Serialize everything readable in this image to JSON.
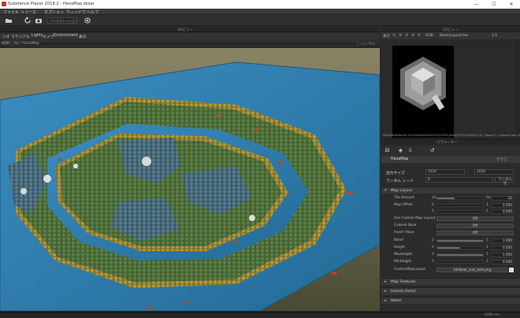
{
  "window": {
    "title": "Substance Player 2018.2 - HexaMap.sbsar",
    "minimize": "—",
    "maximize": "☐",
    "close": "✕"
  },
  "menu": {
    "items": [
      "ファイル",
      "リソース",
      "オプション",
      "ウィンドウ",
      "ヘルプ"
    ]
  },
  "toolbar": {
    "selector": "インテグレーションモード"
  },
  "viewport": {
    "header": "3Dビュー",
    "tabs": [
      "ジオ",
      "マテリアル",
      "Lights",
      "カメラ",
      "Environment",
      "表示"
    ],
    "env_label": "HDR",
    "env_value": "sky / HexaMap",
    "env_right": "ノーマル"
  },
  "preview": {
    "header": "2Dビュー",
    "tools": [
      "表示",
      "①",
      "②",
      "③",
      "④",
      "⑤",
      "RGB",
      "Base/Layout.tex",
      "1:1"
    ],
    "info": "HEXAMAP/BASECOLOR/BOX/HEXA/F/LE/LEVEL/BASE/TXT/CHECK/LCD | Hexa(2) - output3.sbs 2048x2048 | hexa-basecolor.png"
  },
  "properties": {
    "header": "パラメーター",
    "graph_name": "HexaMap",
    "graph_right": "グラフ",
    "output_size_label": "出力サイズ",
    "output_size_w": "1024",
    "output_size_h": "1024",
    "random_seed_label": "ランダム シード",
    "random_seed_value": "0",
    "random_seed_btn": "ランダム化",
    "sections": [
      "Map Layout",
      "Map Features",
      "Islands Detail",
      "Water"
    ],
    "params": [
      {
        "label": "Tile Amount",
        "min": "10",
        "max": "64",
        "value": "32",
        "fill": 0.38
      },
      {
        "label": "Map Offset",
        "min": "0",
        "max": "1",
        "value": "0.000",
        "fill": 0.0
      },
      {
        "label": "",
        "min": "0",
        "max": "1",
        "value": "0.000",
        "fill": 0.0
      },
      {
        "label": "Use Custom Map Layout",
        "wide": "Off"
      },
      {
        "label": "Colored Base",
        "wide": "Off"
      },
      {
        "label": "Invert Value",
        "wide": "Off"
      },
      {
        "label": "Relief",
        "min": "0",
        "max": "1",
        "value": "1.000",
        "fill": 1.0
      },
      {
        "label": "Height",
        "min": "0",
        "max": "1",
        "value": "0.500",
        "fill": 0.5
      },
      {
        "label": "MaxHeight",
        "min": "0",
        "max": "1",
        "value": "1.000",
        "fill": 1.0
      },
      {
        "label": "MinHeight",
        "min": "0",
        "max": "1",
        "value": "0.000",
        "fill": 0.0
      },
      {
        "label": "CustomMapLayout",
        "wide": "10/sbsar_icon_test.png"
      }
    ]
  },
  "status": {
    "right": "4096 ms"
  },
  "colors": {
    "accent": "#3d6fa8",
    "panel": "#2b2b2b",
    "water": "#2f7fb0",
    "grass": "#4e6e3a"
  },
  "icons": [
    "open-file-icon",
    "reload-icon",
    "screenshot-icon",
    "settings-gear-icon"
  ]
}
